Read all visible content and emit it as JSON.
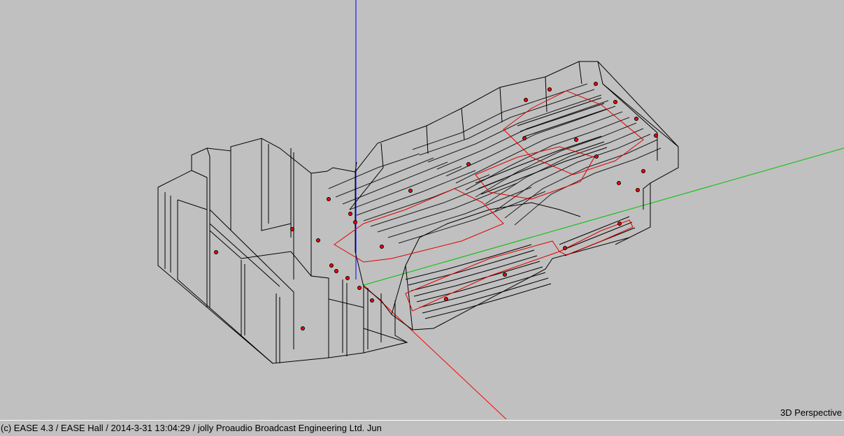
{
  "viewport": {
    "view_mode": "3D Perspective",
    "background_color": "#c0c0c0",
    "axes": {
      "x_color": "#ff0000",
      "y_color": "#00c000",
      "z_color": "#0000ff"
    },
    "wireframe_color": "#000000",
    "audience_area_color": "#e00000",
    "source_marker_color": "#ff0000"
  },
  "status_bar": {
    "text": "(c) EASE 4.3  / EASE Hall  / 2014-3-31 13:04:29 / jolly Proaudio Broadcast Engineering Ltd. Jun"
  }
}
